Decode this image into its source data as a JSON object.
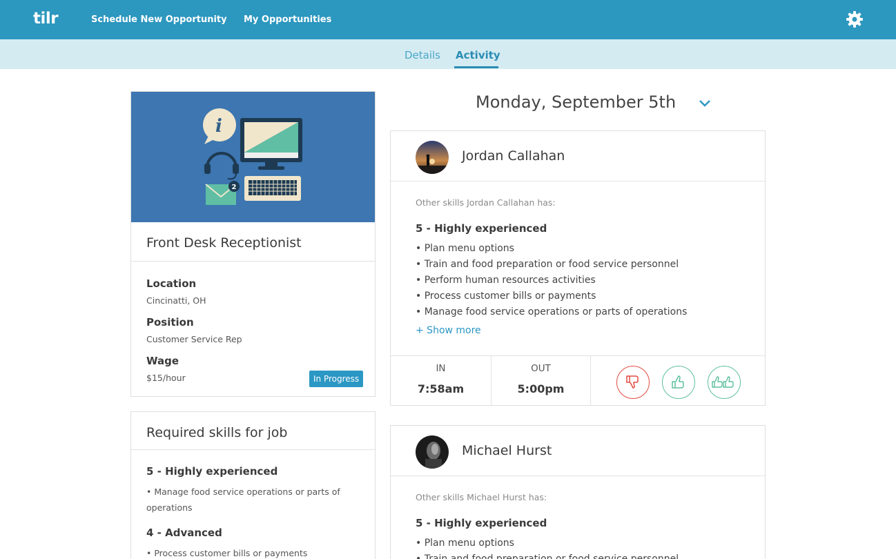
{
  "header": {
    "logo": "tilr",
    "nav": [
      "Schedule New Opportunity",
      "My Opportunities"
    ],
    "settings_icon": "gear-icon",
    "brand_color": "#2c97bf"
  },
  "tabs": [
    "Details",
    "Activity"
  ],
  "active_tab": "Activity",
  "job": {
    "title": "Front Desk Receptionist",
    "location_label": "Location",
    "location": "Cincinatti, OH",
    "position_label": "Position",
    "position": "Customer Service Rep",
    "wage_label": "Wage",
    "wage": "$15/hour",
    "status": "In Progress"
  },
  "required_skills": {
    "title": "Required skills for job",
    "groups": [
      {
        "level": "5 - Highly experienced",
        "items": [
          "• Manage food service operations or parts of operations"
        ]
      },
      {
        "level": "4 - Advanced",
        "items": [
          "• Process customer bills or payments"
        ]
      }
    ]
  },
  "activity": {
    "date": "Monday, September 5th",
    "workers": [
      {
        "name": "Jordan Callahan",
        "other_skills_label": "Other skills Jordan Callahan has:",
        "level": "5 - Highly experienced",
        "skills": [
          "• Plan menu options",
          "• Train and food preparation or food service personnel",
          "• Perform human resources activities",
          "• Process customer bills or payments",
          "• Manage food service operations or parts of operations"
        ],
        "show_more": "+ Show more",
        "in_label": "IN",
        "in_time": "7:58am",
        "out_label": "OUT",
        "out_time": "5:00pm"
      },
      {
        "name": "Michael Hurst",
        "other_skills_label": "Other skills Michael Hurst has:",
        "level": "5 - Highly experienced",
        "skills": [
          "• Plan menu options",
          "• Train and food preparation or food service personnel"
        ]
      }
    ]
  }
}
